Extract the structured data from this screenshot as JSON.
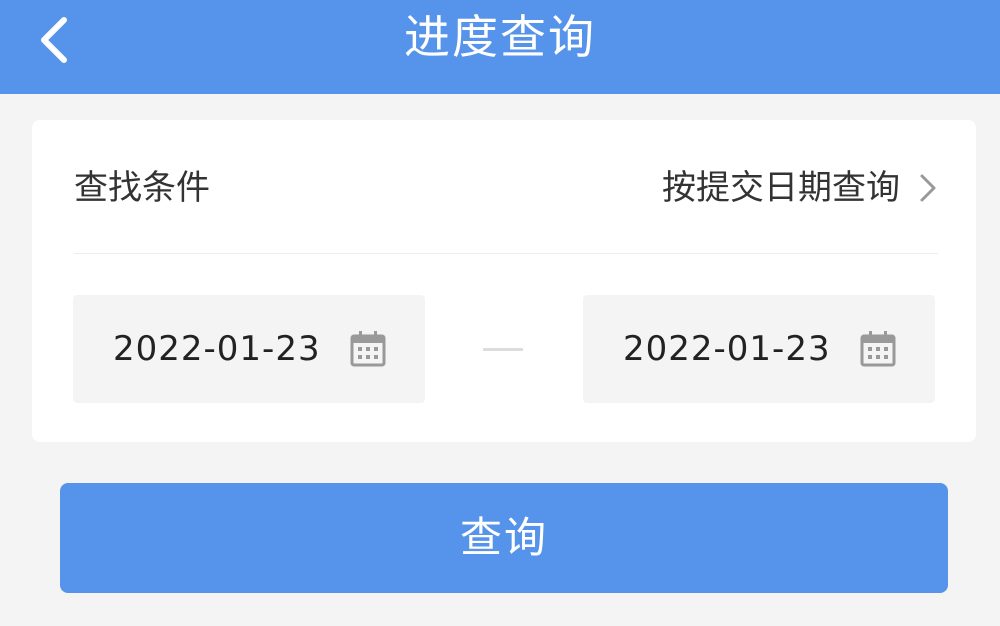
{
  "header": {
    "title": "进度查询",
    "back_icon": "chevron-left-icon"
  },
  "card": {
    "condition_label": "查找条件",
    "condition_value": "按提交日期查询",
    "start_date": "2022-01-23",
    "end_date": "2022-01-23",
    "date_icon": "calendar-icon",
    "range_separator_icon": "dash"
  },
  "actions": {
    "query_label": "查询"
  },
  "colors": {
    "primary": "#5693ea",
    "background": "#f4f4f4",
    "card": "#ffffff",
    "text": "#333333"
  }
}
